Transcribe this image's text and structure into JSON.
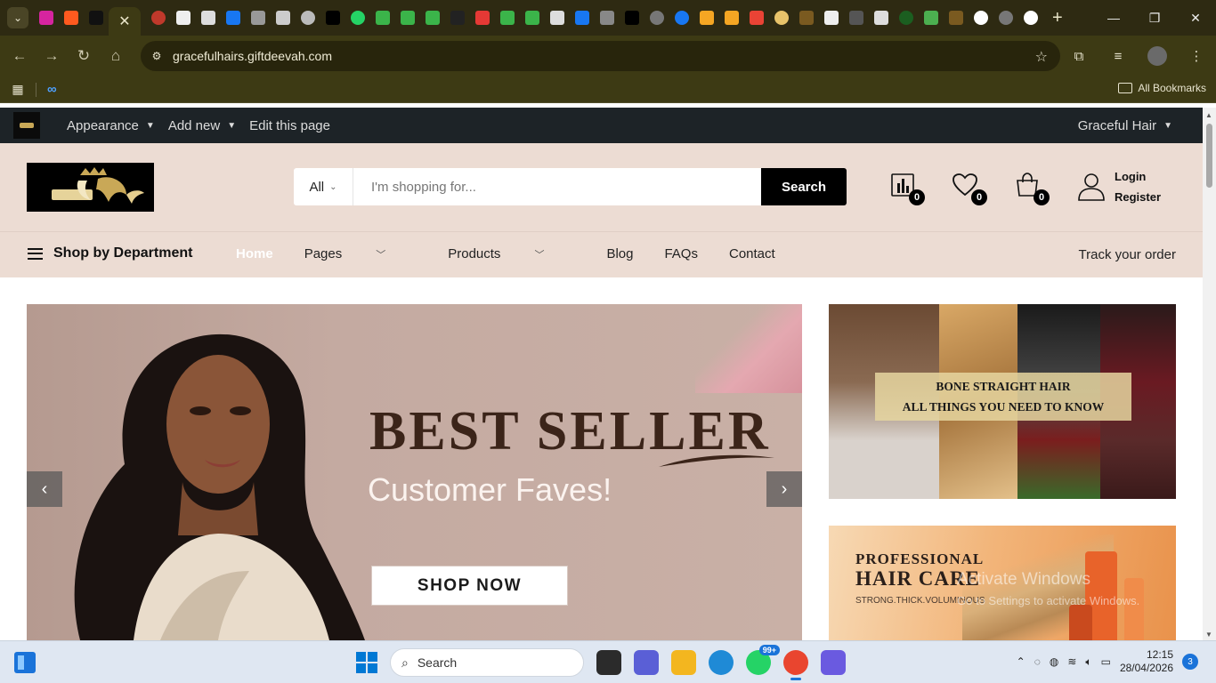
{
  "browser": {
    "url": "gracefulhairs.giftdeevah.com",
    "bookmarks_label": "All Bookmarks",
    "active_tab_close": "✕",
    "new_tab": "+",
    "window_controls": {
      "minimize": "—",
      "maximize": "❐",
      "close": "✕"
    }
  },
  "adminbar": {
    "items": [
      "Appearance",
      "Add new",
      "Edit this page"
    ],
    "site_name": "Graceful Hair"
  },
  "header": {
    "search": {
      "category": "All",
      "placeholder": "I'm shopping for...",
      "button": "Search"
    },
    "compare_count": "0",
    "wishlist_count": "0",
    "cart_count": "0",
    "login": "Login",
    "register": "Register"
  },
  "nav": {
    "department": "Shop by Department",
    "items": {
      "home": "Home",
      "pages": "Pages",
      "products": "Products",
      "blog": "Blog",
      "faqs": "FAQs",
      "contact": "Contact"
    },
    "track": "Track your order"
  },
  "hero": {
    "title": "BEST SELLER",
    "subtitle": "Customer Faves!",
    "cta": "SHOP NOW"
  },
  "side_banner_1": {
    "line1": "BONE STRAIGHT HAIR",
    "line2": "ALL THINGS YOU NEED TO KNOW"
  },
  "side_banner_2": {
    "line1": "PROFESSIONAL",
    "line2": "HAIR CARE",
    "line3": "STRONG.THICK.VOLUMINOUS"
  },
  "watermark": {
    "line1": "Activate Windows",
    "line2": "Go to Settings to activate Windows."
  },
  "taskbar": {
    "search": "Search",
    "whatsapp_badge": "99+",
    "time": "12:15",
    "date": "28/04/2026",
    "notifications": "3"
  },
  "colors": {
    "chrome_bg": "#3d3a14",
    "header_bg": "#ecdcd3",
    "admin_bg": "#1d2327",
    "accent": "#000000"
  }
}
